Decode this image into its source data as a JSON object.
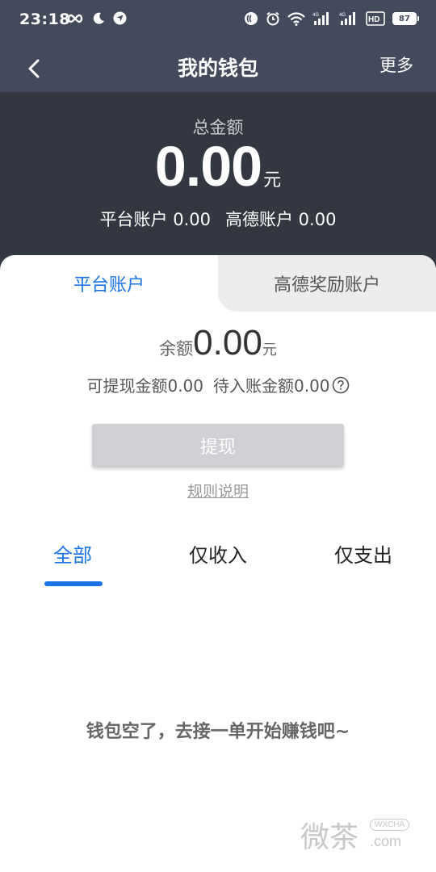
{
  "status_bar": {
    "time": "23:18",
    "battery": "87"
  },
  "nav": {
    "title": "我的钱包",
    "more_label": "更多"
  },
  "summary": {
    "label": "总金额",
    "amount": "0.00",
    "unit": "元",
    "platform_account": "平台账户 0.00",
    "gaode_account": "高德账户 0.00"
  },
  "account_tabs": [
    {
      "label": "平台账户",
      "active": true
    },
    {
      "label": "高德奖励账户",
      "active": false
    }
  ],
  "balance": {
    "label": "余额",
    "amount": "0.00",
    "unit": "元",
    "withdrawable": "可提现金额0.00",
    "pending": "待入账金额0.00"
  },
  "actions": {
    "withdraw_label": "提现",
    "rules_label": "规则说明"
  },
  "filter_tabs": [
    {
      "label": "全部",
      "active": true
    },
    {
      "label": "仅收入",
      "active": false
    },
    {
      "label": "仅支出",
      "active": false
    }
  ],
  "empty_message": "钱包空了，去接一单开始赚钱吧~",
  "watermark": {
    "cn": "微茶",
    "pill": "WXCHA",
    "com": ".com"
  },
  "colors": {
    "header_bg": "#424a5c",
    "summary_bg": "#333741",
    "accent": "#1a73e8",
    "button_disabled": "#cfd0d4"
  },
  "icons": {
    "status_left": [
      "infinity-icon",
      "moon-icon",
      "navigation-app-icon"
    ],
    "status_right": [
      "nfc-icon",
      "alarm-icon",
      "wifi-icon",
      "signal-4g-icon",
      "signal-4g-icon-2",
      "hd-icon",
      "battery-icon"
    ],
    "nav_back": "chevron-left-icon",
    "help": "question-circle-icon"
  }
}
